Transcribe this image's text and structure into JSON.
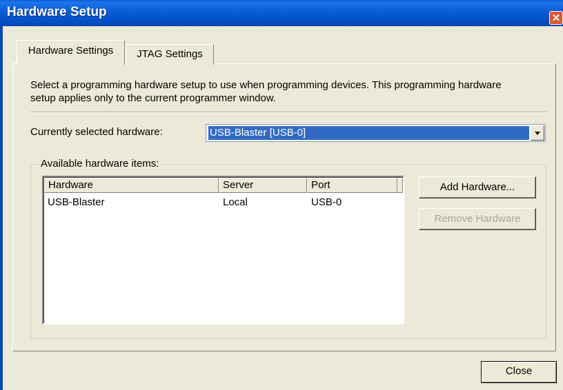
{
  "window": {
    "title": "Hardware Setup",
    "close_glyph": "✕"
  },
  "tabs": [
    {
      "label": "Hardware Settings",
      "active": true
    },
    {
      "label": "JTAG Settings",
      "active": false
    }
  ],
  "description": "Select a programming hardware setup to use when programming devices. This programming hardware setup applies only to the current programmer window.",
  "current_hardware": {
    "label": "Currently selected hardware:",
    "value": "USB-Blaster [USB-0]"
  },
  "available": {
    "legend": "Available hardware items:",
    "columns": [
      "Hardware",
      "Server",
      "Port"
    ],
    "rows": [
      {
        "hardware": "USB-Blaster",
        "server": "Local",
        "port": "USB-0"
      }
    ]
  },
  "buttons": {
    "add": "Add Hardware...",
    "remove": "Remove Hardware",
    "close": "Close"
  },
  "colors": {
    "titlebar": "#0a5fd8",
    "selection": "#316ac5",
    "dialog_bg": "#ece9d8"
  }
}
